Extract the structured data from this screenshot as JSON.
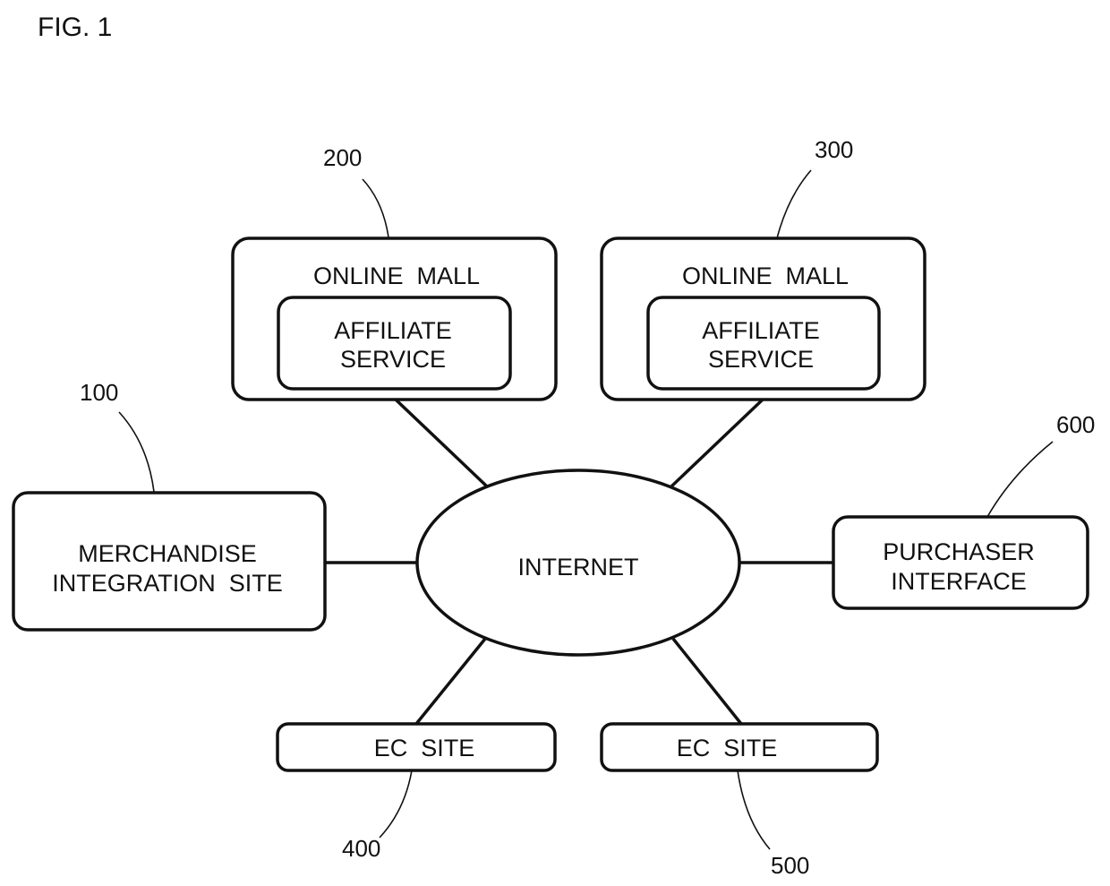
{
  "figure": {
    "title": "FIG. 1"
  },
  "nodes": {
    "online_mall_200": {
      "ref": "200",
      "outer_label": "ONLINE  MALL",
      "inner_label_line1": "AFFILIATE",
      "inner_label_line2": "SERVICE"
    },
    "online_mall_300": {
      "ref": "300",
      "outer_label": "ONLINE  MALL",
      "inner_label_line1": "AFFILIATE",
      "inner_label_line2": "SERVICE"
    },
    "merchandise_site_100": {
      "ref": "100",
      "label_line1": "MERCHANDISE",
      "label_line2": "INTEGRATION  SITE"
    },
    "internet": {
      "label": "INTERNET"
    },
    "purchaser_600": {
      "ref": "600",
      "label_line1": "PURCHASER",
      "label_line2": "INTERFACE"
    },
    "ec_site_400": {
      "ref": "400",
      "label": "EC  SITE"
    },
    "ec_site_500": {
      "ref": "500",
      "label": "EC  SITE"
    }
  },
  "connections": [
    {
      "from": "internet",
      "to": "online_mall_200"
    },
    {
      "from": "internet",
      "to": "online_mall_300"
    },
    {
      "from": "internet",
      "to": "merchandise_site_100"
    },
    {
      "from": "internet",
      "to": "purchaser_600"
    },
    {
      "from": "internet",
      "to": "ec_site_400"
    },
    {
      "from": "internet",
      "to": "ec_site_500"
    }
  ]
}
